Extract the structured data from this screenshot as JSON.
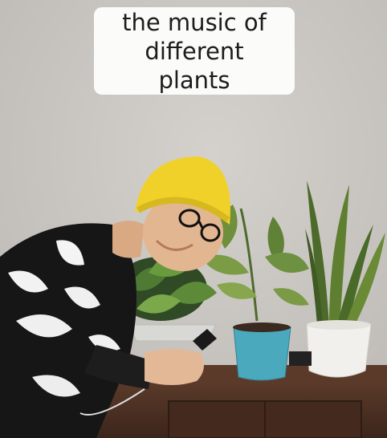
{
  "caption": {
    "text": "the music of different plants"
  },
  "scene": {
    "description_icons": [
      "person",
      "yellow-beanie",
      "glasses",
      "snake-plant",
      "prayer-plant",
      "pothos",
      "dresser"
    ],
    "colors": {
      "wall": "#c8c5c1",
      "beanie": "#f0d12a",
      "dresser": "#4a2f22",
      "blue_pot": "#4aa9bd",
      "white_pot": "#f1f0ec"
    }
  }
}
